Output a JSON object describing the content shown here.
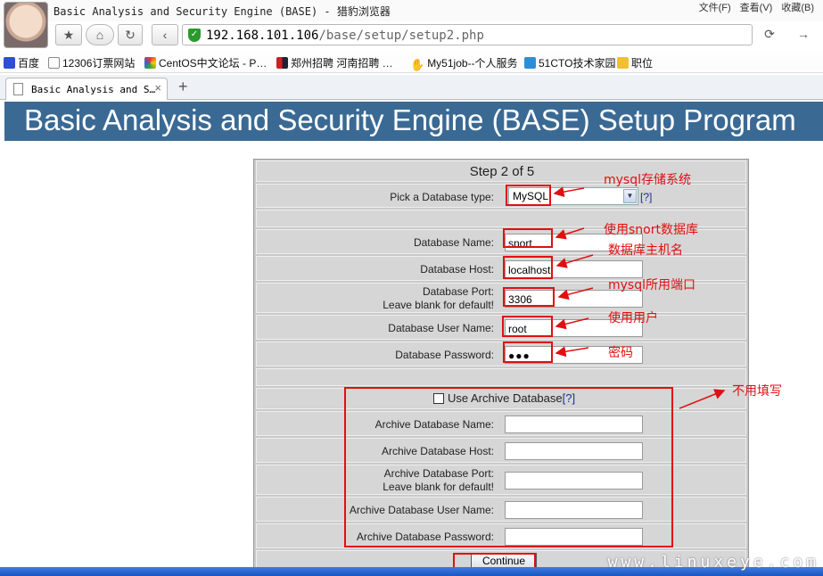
{
  "browser": {
    "window_title": "Basic Analysis and Security Engine (BASE) - 猎豹浏览器",
    "menu": [
      "文件(F)",
      "查看(V)",
      "收藏(B)"
    ],
    "url_host": "192.168.101.106",
    "url_path": "/base/setup/setup2.php",
    "bookmarks": [
      "百度",
      "12306订票网站",
      "CentOS中文论坛 - P…",
      "郑州招聘 河南招聘 …",
      "My51job--个人服务",
      "51CTO技术家园",
      "职位"
    ],
    "tab_label": "Basic Analysis and S…",
    "tab_close": "×",
    "new_tab": "+",
    "icons": [
      "back-icon",
      "forward-icon",
      "home-icon",
      "refresh-icon",
      "star-icon",
      "shield-icon"
    ]
  },
  "banner": {
    "title": "Basic Analysis and Security Engine (BASE) Setup Program"
  },
  "form": {
    "step": "Step 2 of 5",
    "db_type_label": "Pick a Database type:",
    "db_type_value": "MySQL",
    "help": "[?]",
    "db_name_label": "Database Name:",
    "db_name_value": "snort",
    "db_host_label": "Database Host:",
    "db_host_value": "localhost",
    "db_port_label_1": "Database Port:",
    "db_port_label_2": "Leave blank for default!",
    "db_port_value": "3306",
    "db_user_label": "Database User Name:",
    "db_user_value": "root",
    "db_pass_label": "Database Password:",
    "db_pass_value": "●●●",
    "archive_label": "Use Archive Database",
    "archive_help": "[?]",
    "archive_name_label": "Archive Database Name:",
    "archive_host_label": "Archive Database Host:",
    "archive_port_label_1": "Archive Database Port:",
    "archive_port_label_2": "Leave blank for default!",
    "archive_user_label": "Archive Database User Name:",
    "archive_pass_label": "Archive Database Password:",
    "continue": "Continue"
  },
  "annotations": {
    "db_type": "mysql存储系统",
    "db_name": "使用snort数据库",
    "db_host": "数据库主机名",
    "db_port": "mysql所用端口",
    "db_user": "使用用户",
    "db_pass": "密码",
    "archive": "不用填写",
    "color": "#e01010"
  },
  "watermark": "www.linuxeye.com"
}
